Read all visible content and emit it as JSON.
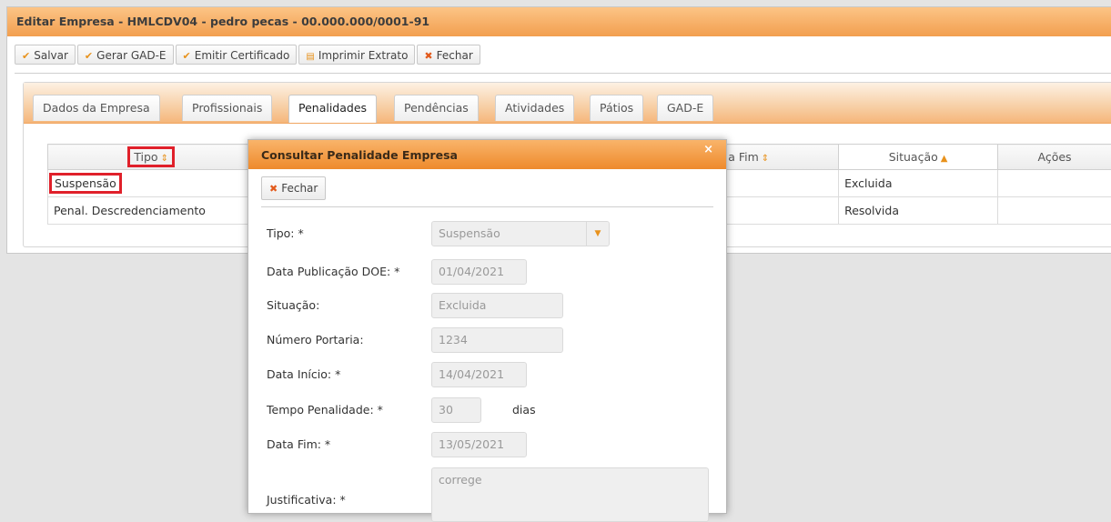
{
  "window": {
    "title": "Editar Empresa - HMLCDV04 - pedro pecas - 00.000.000/0001-91"
  },
  "toolbar": {
    "save": "Salvar",
    "gerar_gad": "Gerar GAD-E",
    "emitir": "Emitir Certificado",
    "imprimir": "Imprimir Extrato",
    "fechar": "Fechar"
  },
  "tabs": [
    {
      "label": "Dados da Empresa"
    },
    {
      "label": "Profissionais"
    },
    {
      "label": "Penalidades"
    },
    {
      "label": "Pendências"
    },
    {
      "label": "Atividades"
    },
    {
      "label": "Pátios"
    },
    {
      "label": "GAD-E"
    }
  ],
  "table": {
    "columns": {
      "tipo": "Tipo",
      "data_fim": "a Fim",
      "situacao": "Situação",
      "acoes": "Ações"
    },
    "rows": [
      {
        "tipo": "Suspensão",
        "situacao": "Excluida"
      },
      {
        "tipo": "Penal. Descredenciamento",
        "situacao": "Resolvida"
      }
    ]
  },
  "modal": {
    "title": "Consultar Penalidade Empresa",
    "close_button": "Fechar",
    "fields": {
      "tipo": {
        "label": "Tipo: *",
        "value": "Suspensão"
      },
      "data_pub": {
        "label": "Data Publicação DOE: *",
        "value": "01/04/2021"
      },
      "situacao": {
        "label": "Situação:",
        "value": "Excluida"
      },
      "portaria": {
        "label": "Número Portaria:",
        "value": "1234"
      },
      "data_inicio": {
        "label": "Data Início: *",
        "value": "14/04/2021"
      },
      "tempo": {
        "label": "Tempo Penalidade: *",
        "value": "30",
        "unit": "dias"
      },
      "data_fim": {
        "label": "Data Fim: *",
        "value": "13/05/2021"
      },
      "justificativa": {
        "label": "Justificativa: *",
        "value": "correge"
      }
    }
  },
  "colors": {
    "accent": "#f29f4f",
    "highlight": "#e0202a"
  }
}
